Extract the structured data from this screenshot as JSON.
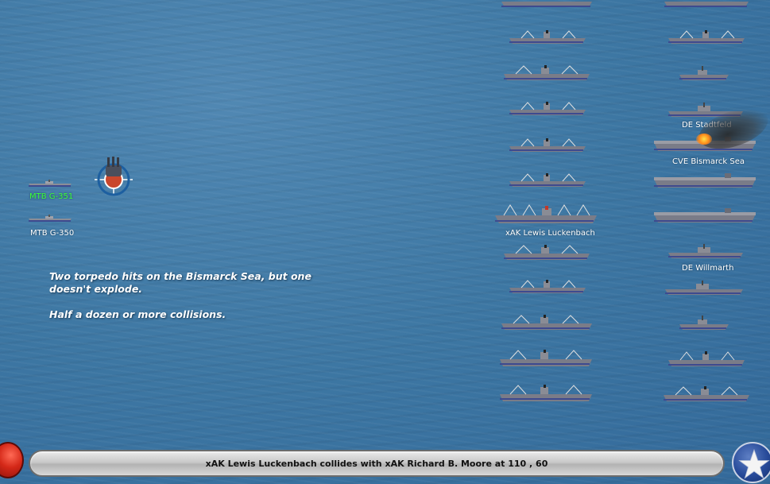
{
  "narrative": {
    "line1": "Two torpedo hits on the Bismarck Sea, but one doesn't explode.",
    "line2": "Half a dozen or more collisions."
  },
  "labels": {
    "mtb_upper": "MTB G-351",
    "mtb_lower": "MTB G-350",
    "xak": "xAK Lewis Luckenbach",
    "de_stadtfeld": "DE Stadtfeld",
    "cve": "CVE Bismarck Sea",
    "de_willmarth": "DE Willmarth"
  },
  "status": {
    "message": "xAK Lewis Luckenbach collides with xAK Richard B. Moore at 110 , 60"
  },
  "colors": {
    "sea": "#3f78a3",
    "selected_label": "#3cff3c",
    "hull": "#7a7c88",
    "hull_stripe": "#3e4a8f"
  },
  "icons": {
    "stop": "red-round-button-icon",
    "end_turn": "white-star-icon",
    "target": "gun-turret-target-icon"
  }
}
